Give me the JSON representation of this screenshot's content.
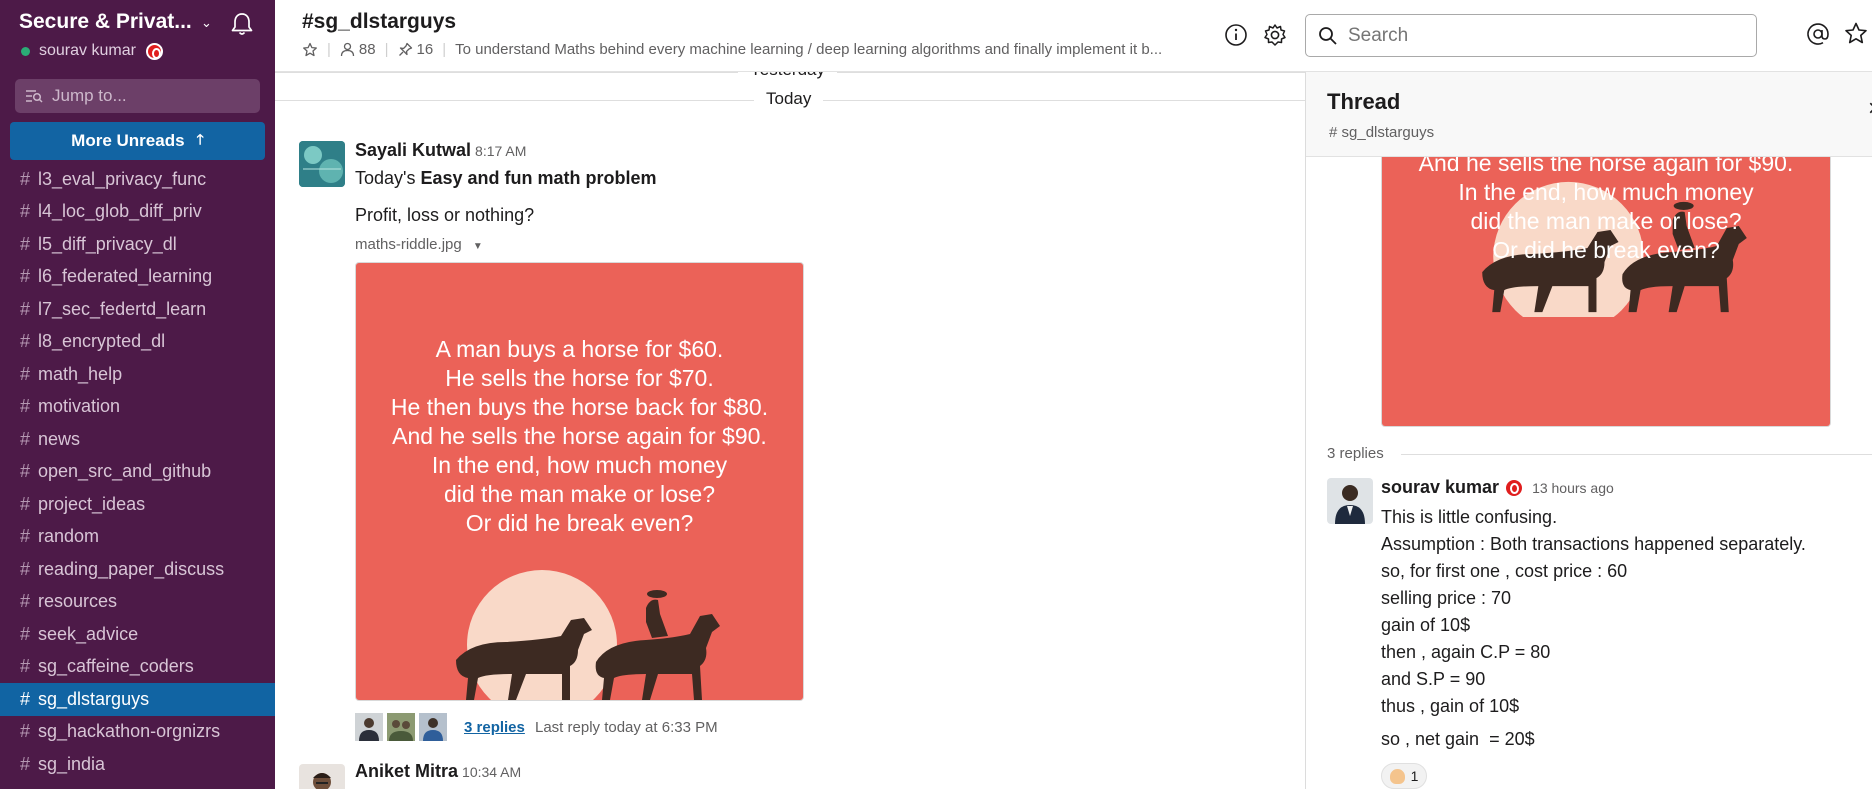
{
  "workspace": {
    "name": "Secure & Privat...",
    "user": "sourav kumar"
  },
  "sidebar": {
    "jump_placeholder": "Jump to...",
    "more_unreads": "More Unreads",
    "channels": [
      "l3_eval_privacy_func",
      "l4_loc_glob_diff_priv",
      "l5_diff_privacy_dl",
      "l6_federated_learning",
      "l7_sec_federtd_learn",
      "l8_encrypted_dl",
      "math_help",
      "motivation",
      "news",
      "open_src_and_github",
      "project_ideas",
      "random",
      "reading_paper_discuss",
      "resources",
      "seek_advice",
      "sg_caffeine_coders",
      "sg_dlstarguys",
      "sg_hackathon-orgnizrs",
      "sg_india"
    ],
    "active_channel": "sg_dlstarguys"
  },
  "header": {
    "channel_title": "#sg_dlstarguys",
    "member_count": "88",
    "pinned_count": "16",
    "topic": "To understand Maths behind every machine learning / deep learning algorithms and finally implement it b...",
    "search_placeholder": "Search"
  },
  "messages": {
    "day_yesterday": "Yesterday",
    "day_today": "Today",
    "msg1": {
      "author": "Sayali Kutwal",
      "time": "8:17 AM",
      "line1_prefix": "Today's ",
      "line1_bold": "Easy and fun math problem",
      "line2": "Profit, loss or nothing?",
      "file_name": "maths-riddle.jpg",
      "replies": "3 replies",
      "last_reply": "Last reply today at 6:33 PM"
    },
    "msg2": {
      "author": "Aniket Mitra",
      "time": "10:34 AM"
    }
  },
  "riddle": {
    "lines": [
      "A man buys a horse for $60.",
      "He sells the horse for $70.",
      "He then buys the horse back for $80.",
      "And he sells the horse again for $90.",
      "In the end, how much money",
      "did the man make or lose?",
      "Or did he break even?"
    ]
  },
  "thread": {
    "title": "Thread",
    "channel": "sg_dlstarguys",
    "reply_count": "3 replies",
    "reply": {
      "author": "sourav kumar",
      "time": "13 hours ago",
      "lines": [
        "This is little confusing.",
        "Assumption : Both transactions happened separately.",
        "so, for first one , cost price : 60",
        "selling price : 70",
        "gain of 10$",
        "then , again C.P = 80",
        "and S.P = 90",
        "thus , gain of 10$"
      ],
      "net": "so , net gain  = 20$",
      "reaction_count": "1"
    }
  },
  "colors": {
    "sidebar_bg": "#4d1a48",
    "active_channel_bg": "#1164a3",
    "unreads_bg": "#1264a3",
    "riddle_bg": "#eb6258",
    "presence": "#2bac76"
  }
}
